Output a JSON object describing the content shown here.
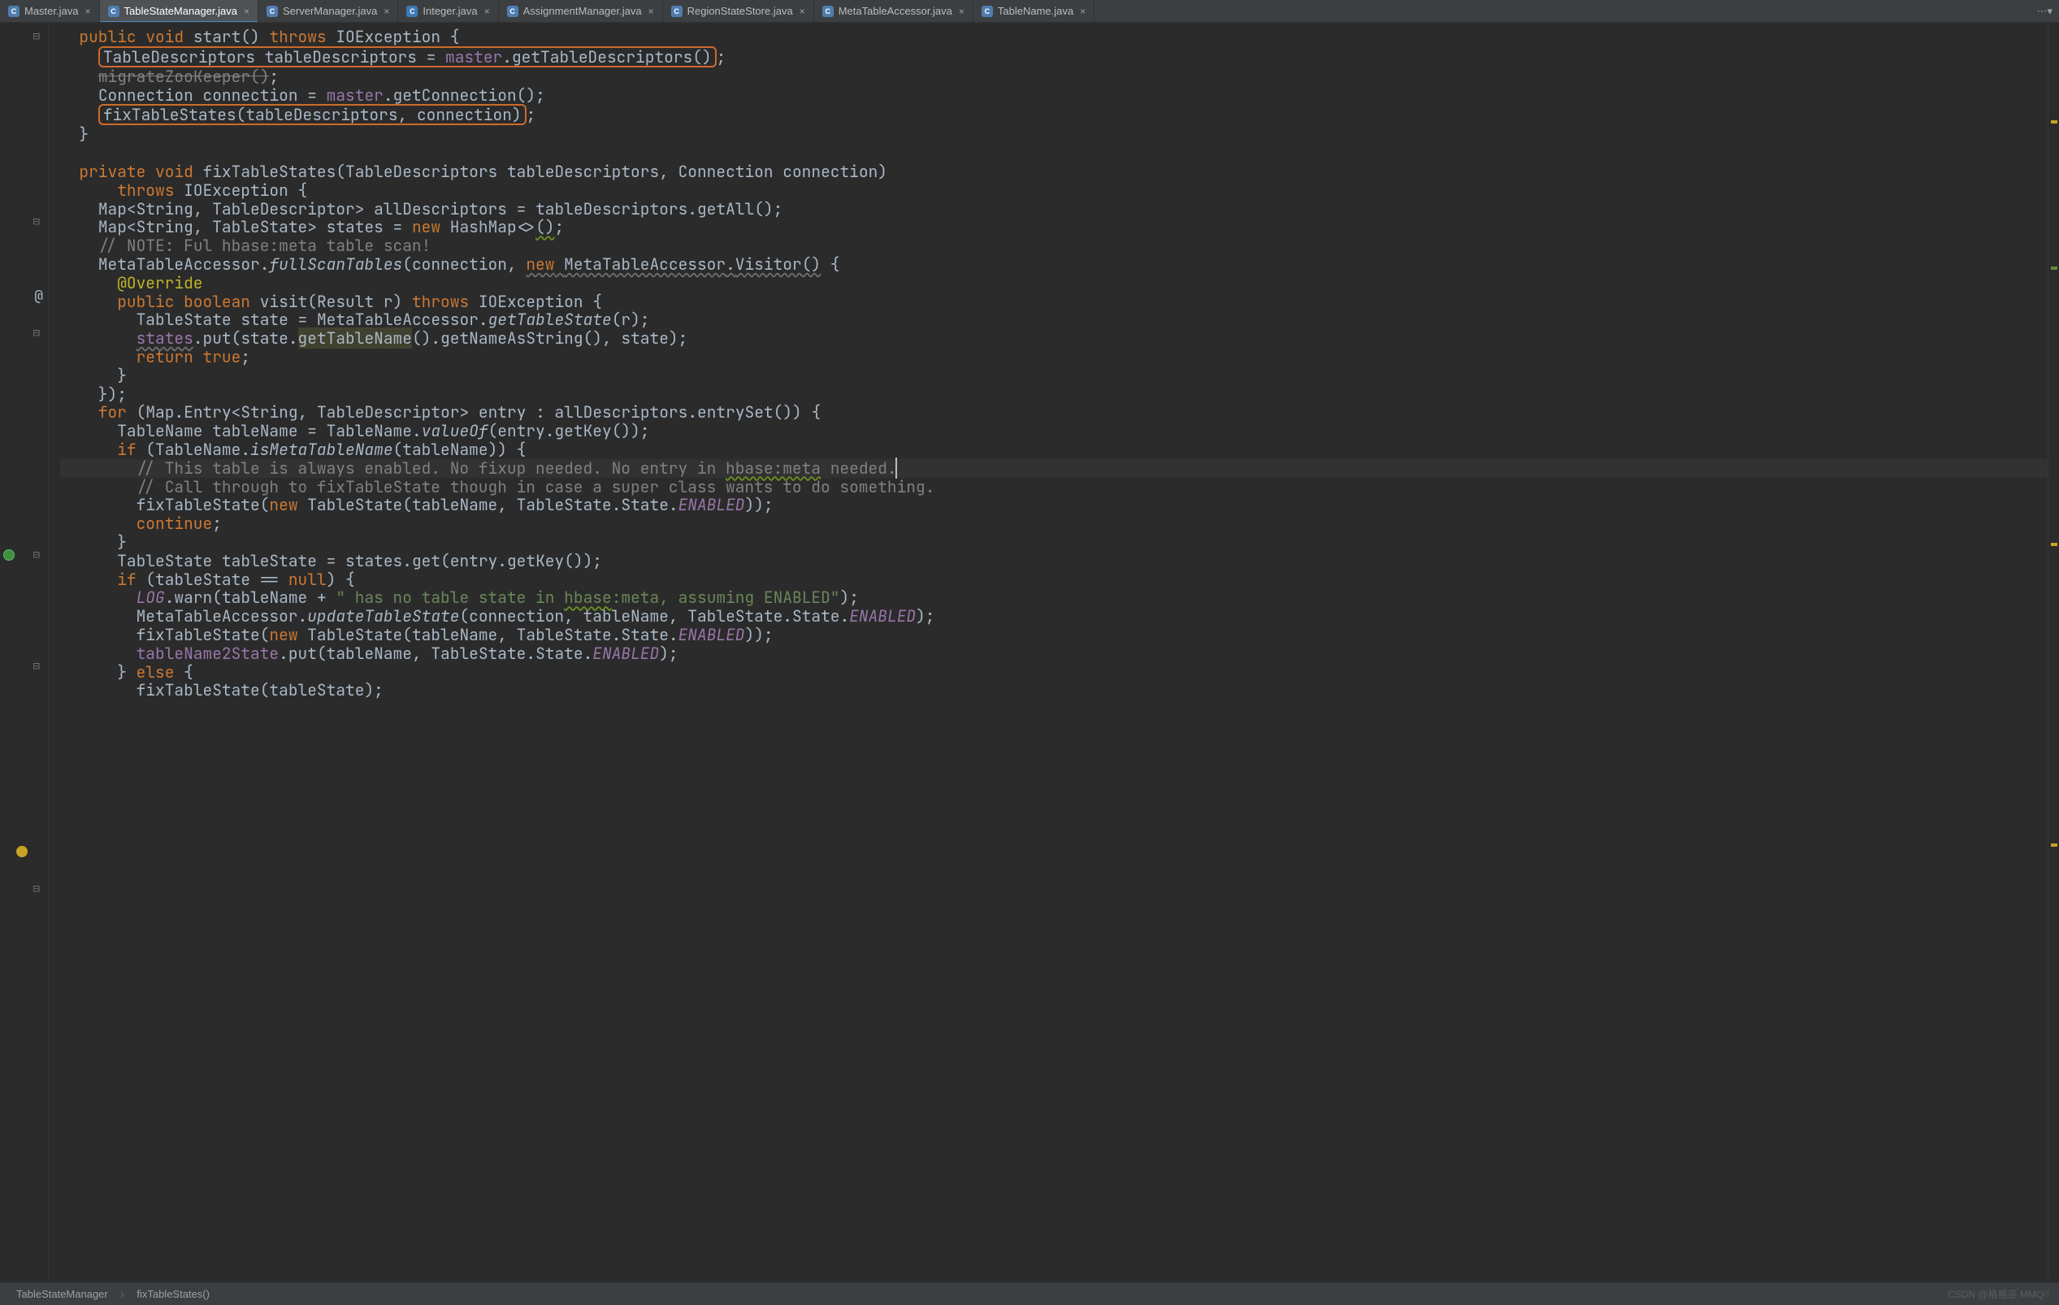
{
  "tabs": [
    {
      "label": "Master.java",
      "icon": "C",
      "icon_class": "fi-class",
      "active": false
    },
    {
      "label": "TableStateManager.java",
      "icon": "C",
      "icon_class": "fi-class",
      "active": true
    },
    {
      "label": "ServerManager.java",
      "icon": "C",
      "icon_class": "fi-class",
      "active": false
    },
    {
      "label": "Integer.java",
      "icon": "C",
      "icon_class": "fi-int",
      "active": false
    },
    {
      "label": "AssignmentManager.java",
      "icon": "C",
      "icon_class": "fi-class",
      "active": false
    },
    {
      "label": "RegionStateStore.java",
      "icon": "C",
      "icon_class": "fi-class",
      "active": false
    },
    {
      "label": "MetaTableAccessor.java",
      "icon": "C",
      "icon_class": "fi-class",
      "active": false
    },
    {
      "label": "TableName.java",
      "icon": "C",
      "icon_class": "fi-class",
      "active": false
    }
  ],
  "breadcrumbs": {
    "crumb1": "TableStateManager",
    "crumb2": "fixTableStates()"
  },
  "watermark": "CSDN @格格巫 MMQ!!",
  "tokens": {
    "public": "public",
    "void": "void",
    "start": "start",
    "throws": "throws",
    "IOException": "IOException",
    "TableDescriptors": "TableDescriptors",
    "tableDescriptors": "tableDescriptors",
    "master": "master",
    "getTableDescriptors": "getTableDescriptors",
    "migrateZooKeeper": "migrateZooKeeper",
    "Connection": "Connection",
    "connection": "connection",
    "getConnection": "getConnection",
    "fixTableStates": "fixTableStates",
    "private": "private",
    "Map": "Map",
    "String": "String",
    "TableDescriptor": "TableDescriptor",
    "allDescriptors": "allDescriptors",
    "getAll": "getAll",
    "TableState": "TableState",
    "states": "states",
    "new": "new",
    "HashMap": "HashMap",
    "note": "// NOTE: Ful hbase:meta table scan!",
    "MetaTableAccessor": "MetaTableAccessor",
    "fullScanTables": "fullScanTables",
    "Visitor": "Visitor",
    "Override": "@Override",
    "boolean": "boolean",
    "visit": "visit",
    "Result": "Result",
    "r": "r",
    "state": "state",
    "getTableState": "getTableState",
    "put": "put",
    "getTableName": "getTableName",
    "getNameAsString": "getNameAsString",
    "return": "return",
    "true": "true",
    "for": "for",
    "Entry": "Entry",
    "entry": "entry",
    "entrySet": "entrySet",
    "TableName": "TableName",
    "tableName": "tableName",
    "valueOf": "valueOf",
    "getKey": "getKey",
    "if": "if",
    "isMetaTableName": "isMetaTableName",
    "c1": "// This table is always enabled. No fixup needed. No entry in ",
    "c1a": "hbase:meta",
    "c1b": " needed.",
    "c2": "// Call through to fixTableState though in case a super class wants to do something.",
    "fixTableState": "fixTableState",
    "State": "State",
    "ENABLED": "ENABLED",
    "continue": "continue",
    "tableState": "tableState",
    "get": "get",
    "null": "null",
    "LOG": "LOG",
    "warn": "warn",
    "str1": "\" has no table state in ",
    "str1a": "hbase",
    "str1b": ":meta, assuming ENABLED\"",
    "updateTableState": "updateTableState",
    "tableName2State": "tableName2State",
    "else": "else"
  }
}
